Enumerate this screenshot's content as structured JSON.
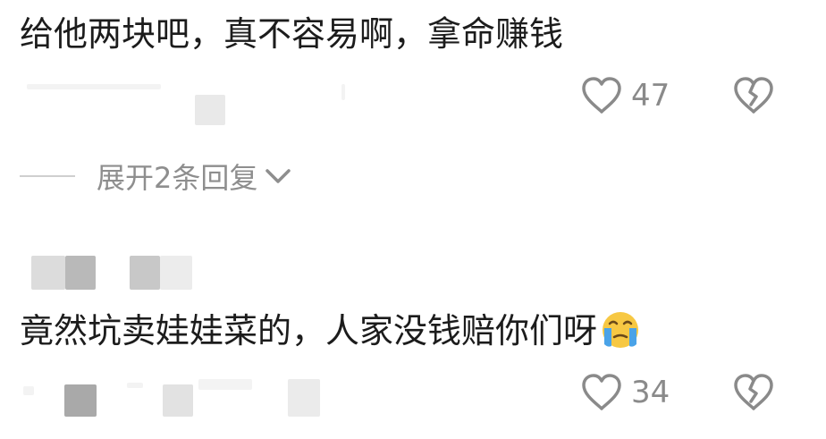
{
  "comments": [
    {
      "text": "给他两块吧，真不容易啊，拿命赚钱",
      "likes": "47"
    },
    {
      "text": "竟然坑卖娃娃菜的，人家没钱赔你们呀",
      "likes": "34",
      "emoji": "crying-face-emoji"
    }
  ],
  "replies": {
    "expand_label": "展开2条回复"
  },
  "icons": {
    "like": "heart-outline-icon",
    "dislike": "broken-heart-icon",
    "expand": "chevron-down-icon"
  },
  "colors": {
    "icon_gray": "#8a8a8a",
    "text_dark": "#1c1c1c",
    "expand_text": "#8e8e8e",
    "emoji_yellow": "#f7c843",
    "emoji_tear": "#4aa3e8"
  }
}
